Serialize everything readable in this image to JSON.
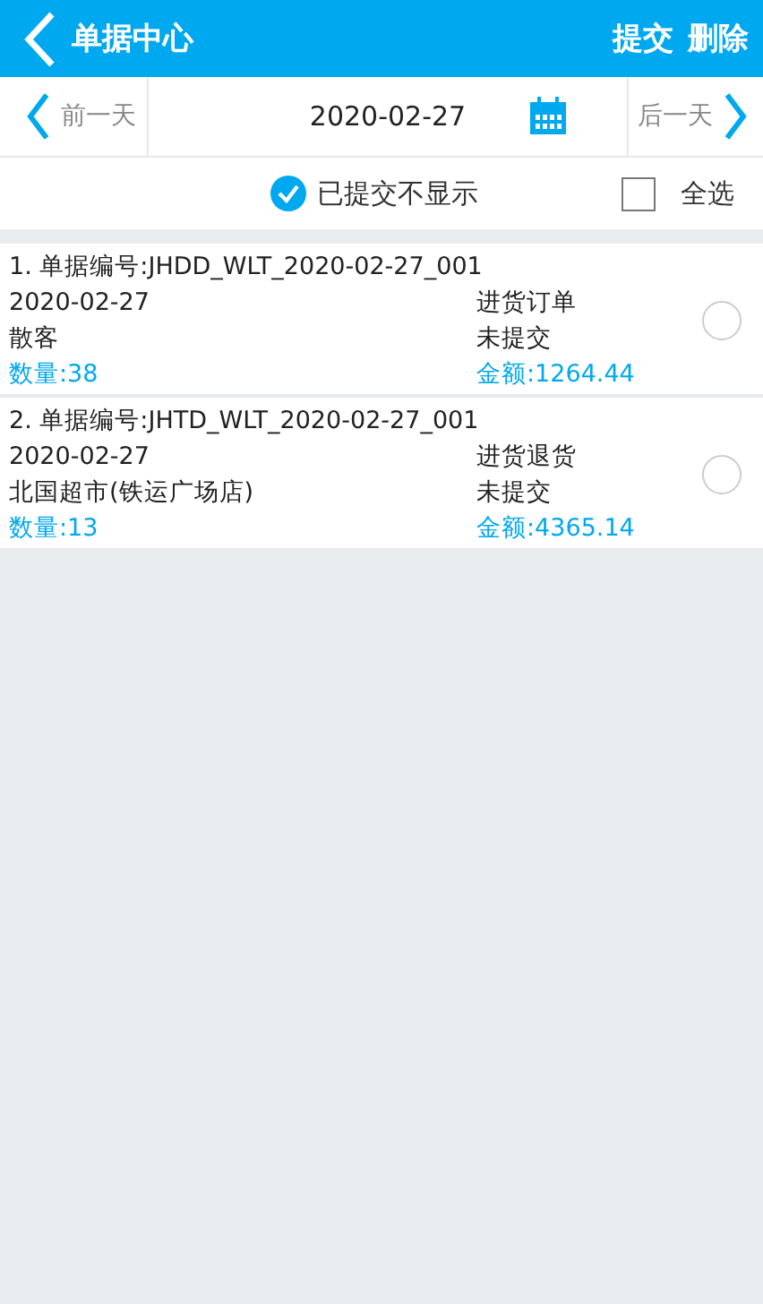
{
  "header": {
    "title": "单据中心",
    "actions": [
      "提交",
      "删除"
    ]
  },
  "date_bar": {
    "prev": "前一天",
    "date": "2020-02-27",
    "next": "后一天"
  },
  "filters": {
    "hide_submitted": {
      "label": "已提交不显示",
      "checked": true
    },
    "select_all": {
      "label": "全选",
      "checked": false
    }
  },
  "orders": [
    {
      "number": "1. 单据编号:JHDD_WLT_2020-02-27_001",
      "date": "2020-02-27",
      "type": "进货订单",
      "customer": "散客",
      "status": "未提交",
      "quantity": "数量:38",
      "amount": "金额:1264.44",
      "selected": false
    },
    {
      "number": "2. 单据编号:JHTD_WLT_2020-02-27_001",
      "date": "2020-02-27",
      "type": "进货退货",
      "customer": "北国超市(铁运广场店)",
      "status": "未提交",
      "quantity": "数量:13",
      "amount": "金额:4365.14",
      "selected": false
    }
  ]
}
